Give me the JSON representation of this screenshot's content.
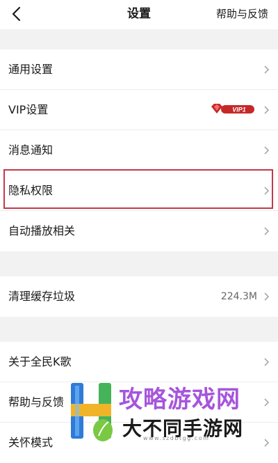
{
  "header": {
    "title": "设置",
    "help_label": "帮助与反馈"
  },
  "groups": [
    {
      "items": [
        {
          "label": "通用设置"
        },
        {
          "label": "VIP设置",
          "badge": "VIP1"
        },
        {
          "label": "消息通知"
        },
        {
          "label": "隐私权限",
          "highlighted": true
        },
        {
          "label": "自动播放相关"
        }
      ]
    },
    {
      "items": [
        {
          "label": "清理缓存垃圾",
          "value": "224.3M"
        }
      ]
    },
    {
      "items": [
        {
          "label": "关于全民K歌"
        },
        {
          "label": "帮助与反馈"
        },
        {
          "label": "关怀模式"
        }
      ]
    }
  ],
  "watermark": {
    "line1": "攻略游戏网",
    "line2": "大不同手游网",
    "url": "www.szdbtgg.com"
  },
  "colors": {
    "highlight_border": "#c0394b",
    "vip_badge": "#c62828",
    "watermark_purple": "#9a3ed8"
  }
}
